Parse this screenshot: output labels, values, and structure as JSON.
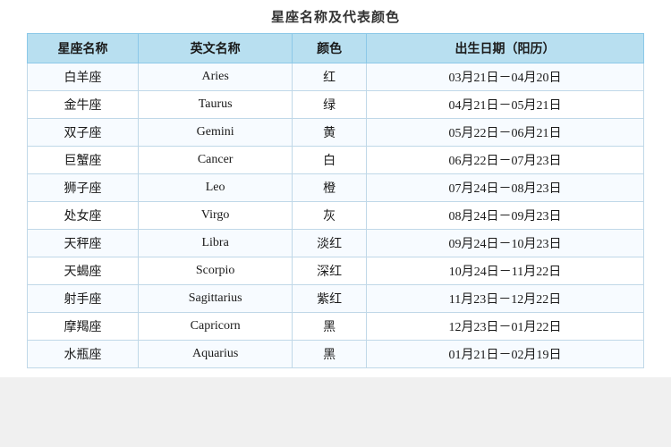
{
  "page": {
    "title": "星座名称及代表颜色",
    "headers": [
      "星座名称",
      "英文名称",
      "颜色",
      "出生日期（阳历）"
    ],
    "rows": [
      {
        "zh": "白羊座",
        "en": "Aries",
        "color": "红",
        "date": "03月21日－04月20日"
      },
      {
        "zh": "金牛座",
        "en": "Taurus",
        "color": "绿",
        "date": "04月21日－05月21日"
      },
      {
        "zh": "双子座",
        "en": "Gemini",
        "color": "黄",
        "date": "05月22日－06月21日"
      },
      {
        "zh": "巨蟹座",
        "en": "Cancer",
        "color": "白",
        "date": "06月22日－07月23日"
      },
      {
        "zh": "狮子座",
        "en": "Leo",
        "color": "橙",
        "date": "07月24日－08月23日"
      },
      {
        "zh": "处女座",
        "en": "Virgo",
        "color": "灰",
        "date": "08月24日－09月23日"
      },
      {
        "zh": "天秤座",
        "en": "Libra",
        "color": "淡红",
        "date": "09月24日－10月23日"
      },
      {
        "zh": "天蝎座",
        "en": "Scorpio",
        "color": "深红",
        "date": "10月24日－11月22日"
      },
      {
        "zh": "射手座",
        "en": "Sagittarius",
        "color": "紫红",
        "date": "11月23日－12月22日"
      },
      {
        "zh": "摩羯座",
        "en": "Capricorn",
        "color": "黑",
        "date": "12月23日－01月22日"
      },
      {
        "zh": "水瓶座",
        "en": "Aquarius",
        "color": "黑",
        "date": "01月21日－02月19日"
      }
    ]
  }
}
